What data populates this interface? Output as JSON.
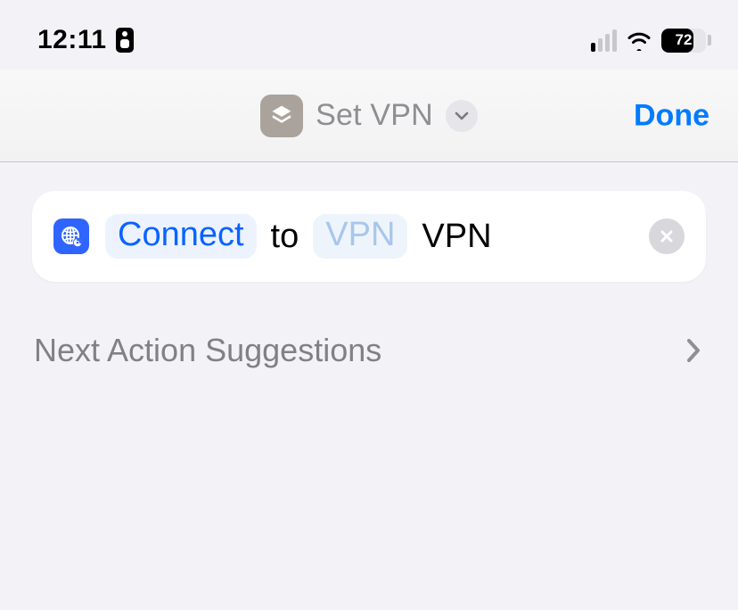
{
  "statusbar": {
    "time": "12:11",
    "battery_pct": "72"
  },
  "navbar": {
    "title": "Set VPN",
    "done": "Done"
  },
  "action": {
    "connect": "Connect",
    "to": "to",
    "vpn_param": "VPN",
    "vpn_label": "VPN"
  },
  "suggestion": {
    "label": "Next Action Suggestions"
  }
}
